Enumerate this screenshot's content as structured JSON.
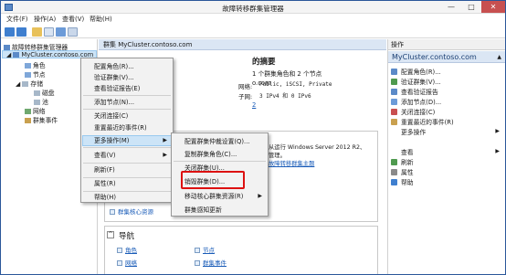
{
  "window": {
    "title": "故障转移群集管理器",
    "min": "—",
    "max": "□",
    "close": "✕"
  },
  "menubar": {
    "file": "文件(F)",
    "action": "操作(A)",
    "view": "查看(V)",
    "help": "帮助(H)"
  },
  "tree": {
    "root": "故障转移群集管理器",
    "cluster": "MyCluster.contoso.com",
    "items": [
      "角色",
      "节点",
      "存储",
      "磁盘",
      "池",
      "网络",
      "群集事件"
    ]
  },
  "center": {
    "header": "群集 MyCluster.contoso.com",
    "title_fragment": "的摘要",
    "sub_fragment": "1 个群集角色和 2 个节点",
    "domain_fragment": "o.com",
    "link_fragment": "2",
    "networks_label": "网络:",
    "networks_value": "Public, iSCSI, Private",
    "subnets_label": "子网:",
    "subnets_value": "3 IPv4 和 0 IPv6",
    "info_line1": "从运行 Windows Server 2012 R2、",
    "info_line2": "管理。",
    "info_link": "故障转移群集主题",
    "bottom_link": "群集核心资源",
    "nav_title": "导航",
    "nav_links": [
      "角色",
      "节点",
      "网络",
      "群集事件"
    ]
  },
  "actions": {
    "header": "操作",
    "section": "MyCluster.contoso.com",
    "items": [
      "配置角色(R)...",
      "验证群集(V)...",
      "查看验证报告",
      "添加节点(D)...",
      "关闭连接(C)",
      "重置最近的事件(R)",
      "更多操作",
      "查看",
      "刷新",
      "属性",
      "帮助"
    ]
  },
  "context_menu": {
    "items": [
      "配置角色(R)...",
      "验证群集(V)...",
      "查看验证报告(E)",
      "添加节点(N)...",
      "关闭连接(C)",
      "重置最近的事件(R)",
      "更多操作(M)",
      "查看(V)",
      "刷新(F)",
      "属性(R)",
      "帮助(H)"
    ]
  },
  "submenu": {
    "items": [
      "配置群集仲裁设置(Q)...",
      "复制群集角色(C)...",
      "关闭群集(U)...",
      "销毁群集(D)...",
      "移动核心群集资源(R)",
      "群集感知更新"
    ]
  }
}
